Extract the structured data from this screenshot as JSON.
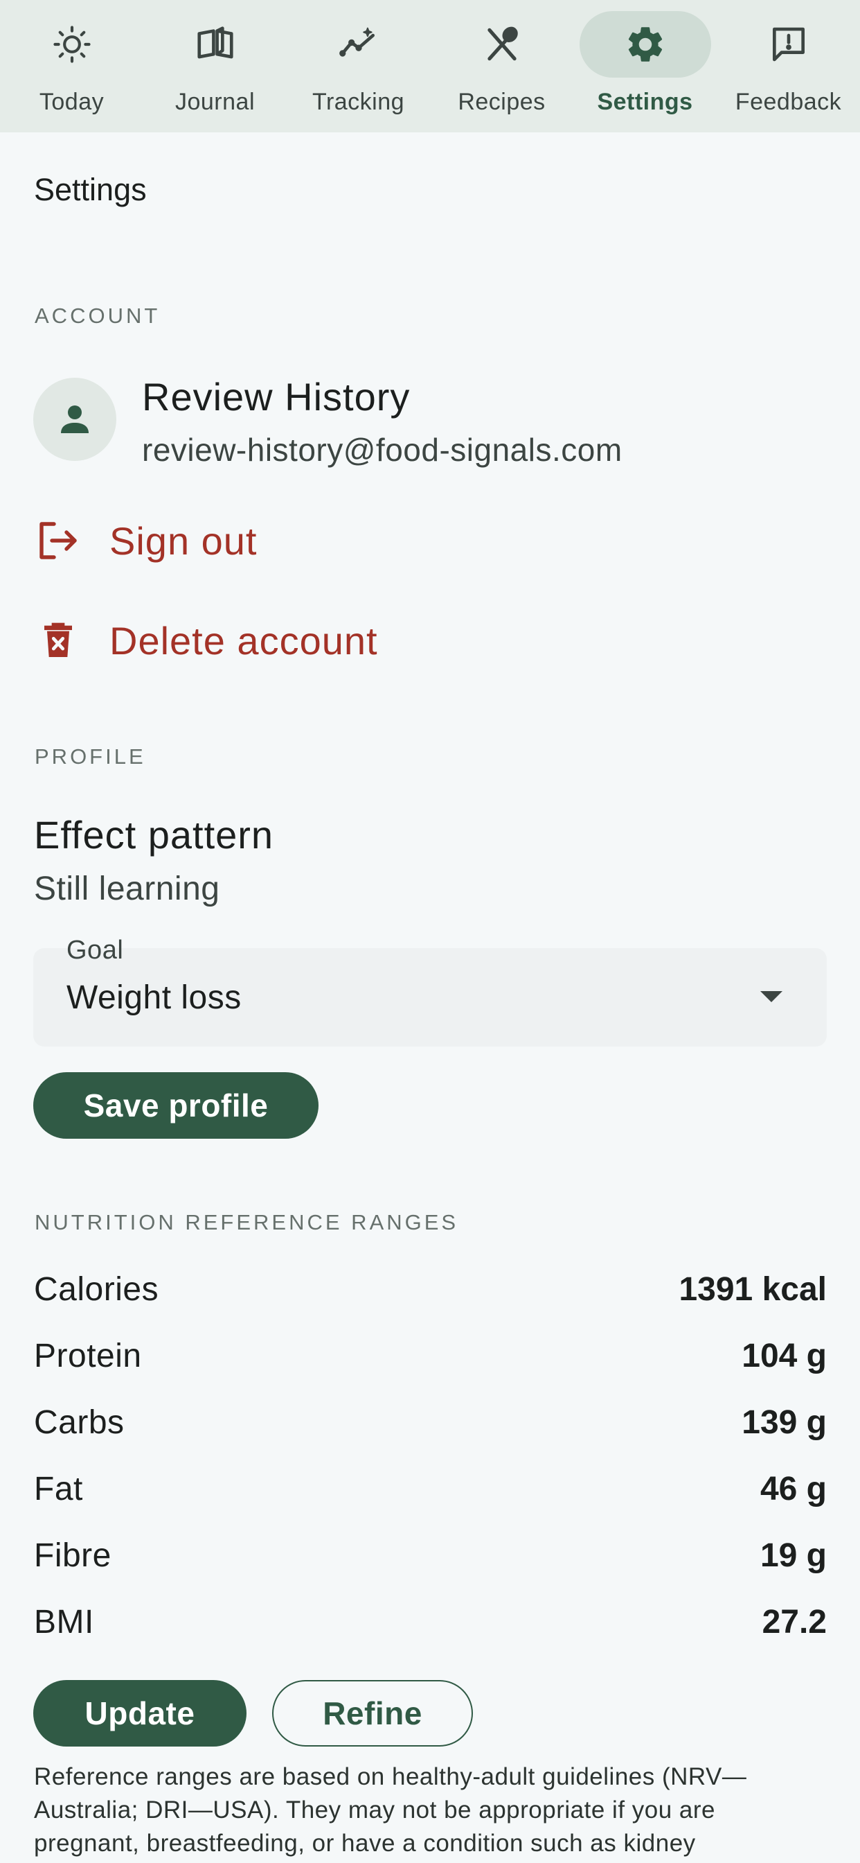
{
  "nav": {
    "items": [
      {
        "label": "Today",
        "icon": "sun-icon"
      },
      {
        "label": "Journal",
        "icon": "book-icon"
      },
      {
        "label": "Tracking",
        "icon": "trend-sparkle-icon"
      },
      {
        "label": "Recipes",
        "icon": "utensils-icon"
      },
      {
        "label": "Settings",
        "icon": "gear-icon"
      },
      {
        "label": "Feedback",
        "icon": "feedback-icon"
      }
    ],
    "active": "Settings"
  },
  "page": {
    "title": "Settings"
  },
  "account": {
    "section": "ACCOUNT",
    "name": "Review History",
    "email": "review-history@food-signals.com",
    "sign_out": "Sign out",
    "delete": "Delete account"
  },
  "profile": {
    "section": "PROFILE",
    "effect_title": "Effect pattern",
    "effect_value": "Still learning",
    "goal_label": "Goal",
    "goal_value": "Weight loss",
    "save": "Save profile"
  },
  "nutrition": {
    "section": "NUTRITION REFERENCE RANGES",
    "rows": [
      {
        "label": "Calories",
        "value": "1391 kcal"
      },
      {
        "label": "Protein",
        "value": "104 g"
      },
      {
        "label": "Carbs",
        "value": "139 g"
      },
      {
        "label": "Fat",
        "value": "46 g"
      },
      {
        "label": "Fibre",
        "value": "19 g"
      },
      {
        "label": "BMI",
        "value": "27.2"
      }
    ],
    "update": "Update",
    "refine": "Refine",
    "disclaimer": "Reference ranges are based on healthy-adult guidelines (NRV—Australia; DRI—USA). They may not be appropriate if you are pregnant, breastfeeding, or have a condition such as kidney"
  },
  "colors": {
    "accent": "#305a45",
    "danger": "#a33227",
    "nav_bg": "#e5ece8",
    "page_bg": "#f5f8f9"
  }
}
